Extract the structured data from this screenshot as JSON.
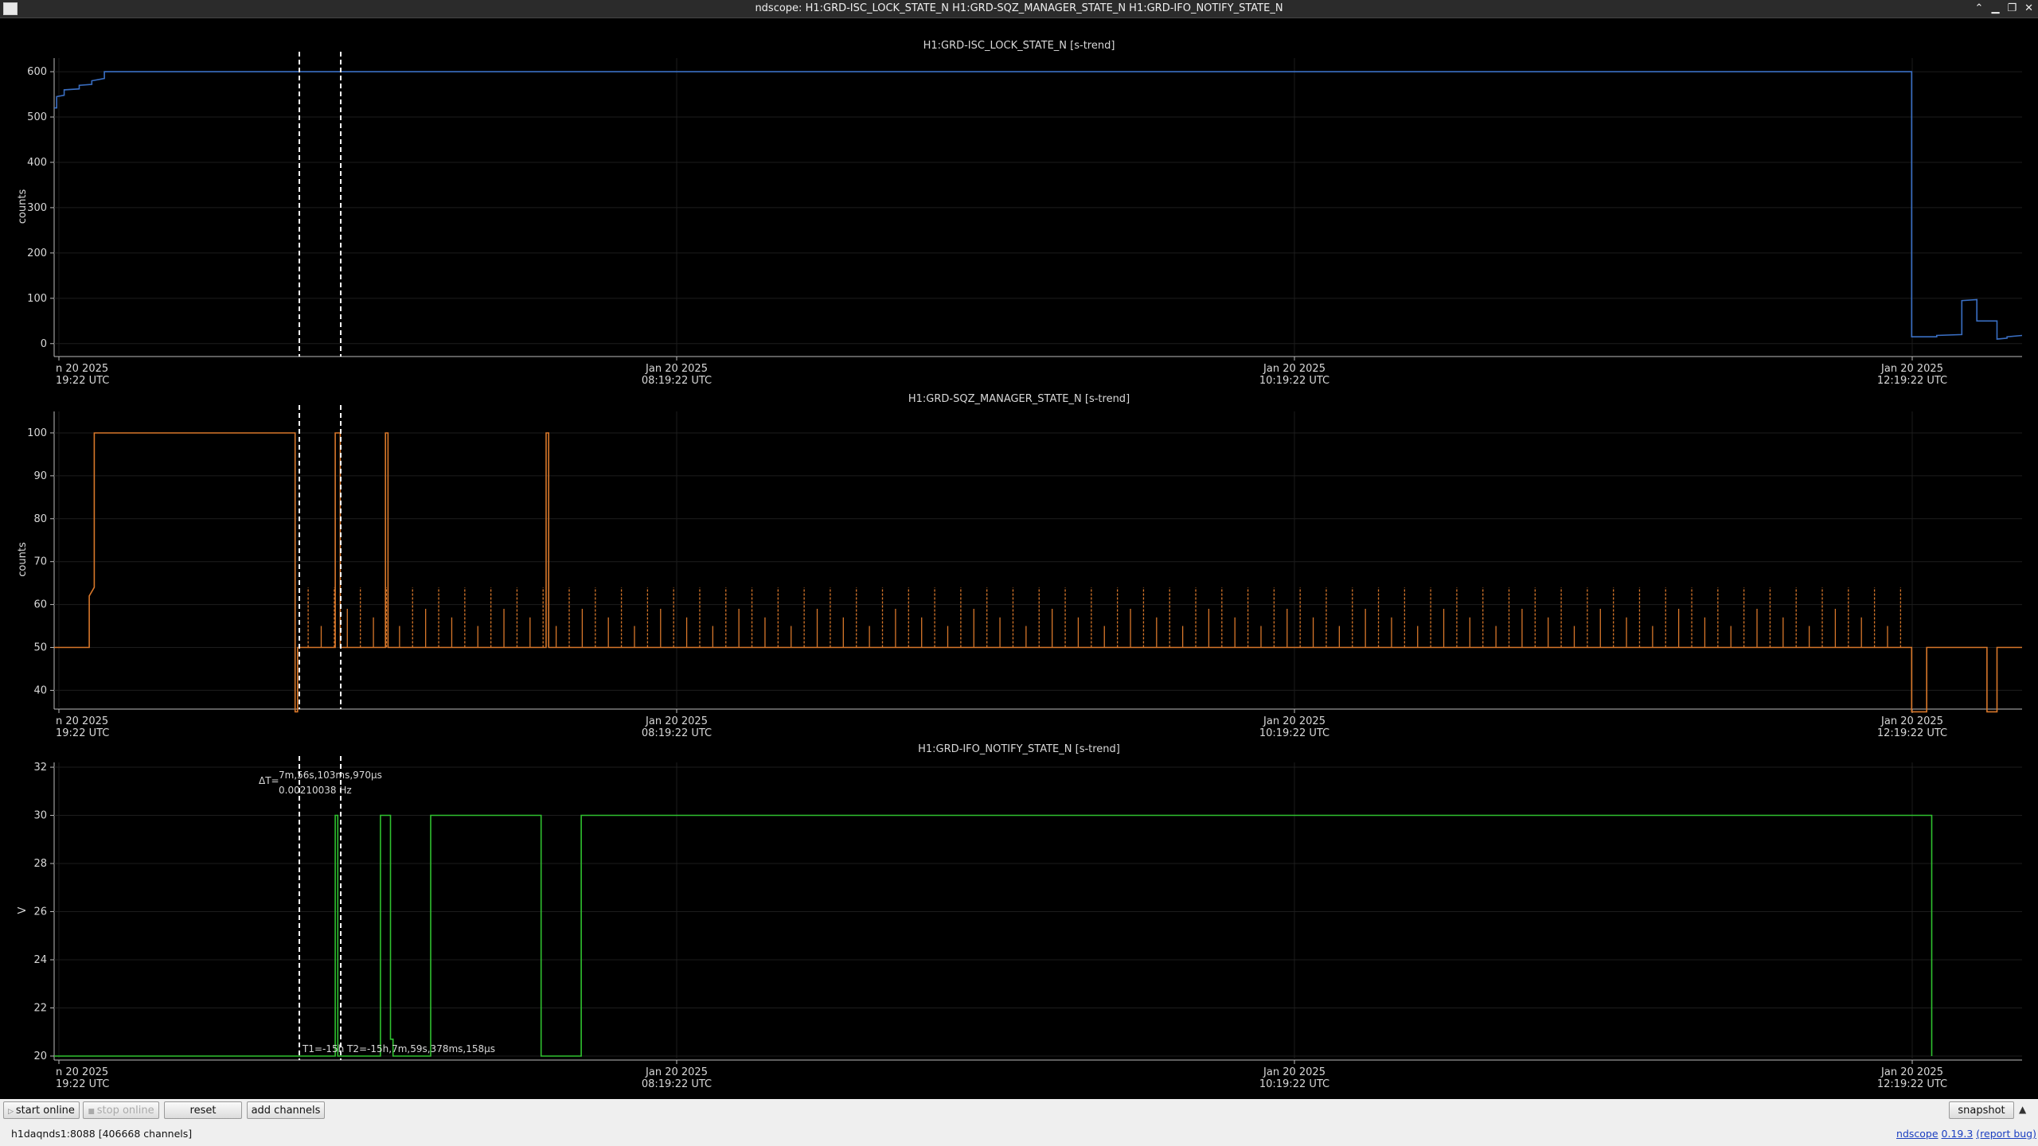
{
  "window": {
    "title": "ndscope: H1:GRD-ISC_LOCK_STATE_N H1:GRD-SQZ_MANAGER_STATE_N H1:GRD-IFO_NOTIFY_STATE_N",
    "buttons": {
      "minimize": "▁",
      "maximize": "❐",
      "close": "✕",
      "shade": "⌃"
    }
  },
  "time_ticks": [
    {
      "label1": "n 20 2025",
      "label2": "19:22 UTC"
    },
    {
      "label1": "Jan 20 2025",
      "label2": "08:19:22 UTC"
    },
    {
      "label1": "Jan 20 2025",
      "label2": "10:19:22 UTC"
    },
    {
      "label1": "Jan 20 2025",
      "label2": "12:19:22 UTC"
    }
  ],
  "cursors": {
    "delta_label": "ΔT=",
    "delta_time": "7m,56s,103ms,970µs",
    "delta_freq": "0.00210038 Hz",
    "t_labels": "T1=-15h T2=-15h,7m,59s,378ms,158µs"
  },
  "chart_data": [
    {
      "type": "line",
      "title": "H1:GRD-ISC_LOCK_STATE_N [s-trend]",
      "ylabel": "counts",
      "ylim": [
        -25,
        630
      ],
      "yticks": [
        "0",
        "100",
        "200",
        "300",
        "400",
        "500",
        "600"
      ],
      "color": "#3a6fc4",
      "series": [
        {
          "values": [
            [
              0,
              520
            ],
            [
              0.5,
              520
            ],
            [
              0.5,
              545
            ],
            [
              2,
              548
            ],
            [
              2,
              560
            ],
            [
              5,
              562
            ],
            [
              5,
              570
            ],
            [
              7.5,
              572
            ],
            [
              7.5,
              580
            ],
            [
              10,
              585
            ],
            [
              10,
              600
            ],
            [
              370,
              600
            ],
            [
              370,
              15
            ],
            [
              375,
              15
            ],
            [
              375,
              18
            ],
            [
              380,
              20
            ],
            [
              380,
              95
            ],
            [
              383,
              97
            ],
            [
              383,
              50
            ],
            [
              387,
              50
            ],
            [
              387,
              10
            ],
            [
              389,
              12
            ],
            [
              389,
              15
            ],
            [
              392,
              18
            ]
          ]
        }
      ]
    },
    {
      "type": "line",
      "title": "H1:GRD-SQZ_MANAGER_STATE_N [s-trend]",
      "ylabel": "counts",
      "ylim": [
        36,
        105
      ],
      "yticks": [
        "40",
        "50",
        "60",
        "70",
        "80",
        "90",
        "100"
      ],
      "color": "#d8772a",
      "series": [
        {
          "values": [
            [
              0,
              50
            ],
            [
              7,
              50
            ],
            [
              7,
              62
            ],
            [
              8,
              64
            ],
            [
              8,
              100
            ],
            [
              48,
              100
            ],
            [
              48,
              35
            ],
            [
              48.5,
              35
            ],
            [
              48.5,
              50
            ],
            [
              56,
              50
            ],
            [
              56,
              100
            ],
            [
              57,
              100
            ],
            [
              57,
              50
            ],
            [
              66,
              50
            ],
            [
              66,
              100
            ],
            [
              66.5,
              100
            ],
            [
              66.5,
              50
            ],
            [
              98,
              50
            ],
            [
              98,
              100
            ],
            [
              98.5,
              100
            ],
            [
              98.5,
              50
            ],
            [
              370,
              50
            ],
            [
              370,
              35
            ],
            [
              373,
              35
            ],
            [
              373,
              50
            ],
            [
              385,
              50
            ],
            [
              385,
              35
            ],
            [
              387,
              35
            ],
            [
              387,
              50
            ],
            [
              392,
              50
            ]
          ]
        }
      ],
      "spikes": {
        "from": 48,
        "to": 370,
        "step": 2.6,
        "heights": [
          57,
          64,
          55,
          64,
          59,
          64
        ]
      }
    },
    {
      "type": "line",
      "title": "H1:GRD-IFO_NOTIFY_STATE_N [s-trend]",
      "ylabel": "V",
      "ylim": [
        19.9,
        32.2
      ],
      "yticks": [
        "20",
        "22",
        "24",
        "26",
        "28",
        "30",
        "32"
      ],
      "color": "#2fc12f",
      "series": [
        {
          "values": [
            [
              0,
              20
            ],
            [
              48,
              20
            ],
            [
              56,
              20
            ],
            [
              56,
              30
            ],
            [
              56.5,
              30
            ],
            [
              56.5,
              20
            ],
            [
              65,
              20
            ],
            [
              65,
              30
            ],
            [
              67,
              30
            ],
            [
              67,
              20.7
            ],
            [
              67.5,
              20.7
            ],
            [
              67.5,
              20
            ],
            [
              75,
              20
            ],
            [
              75,
              30
            ],
            [
              97,
              30
            ],
            [
              97,
              20
            ],
            [
              105,
              20
            ],
            [
              105,
              30
            ],
            [
              374,
              30
            ],
            [
              374,
              20
            ]
          ]
        }
      ]
    }
  ],
  "toolbar": {
    "start_online": "start online",
    "stop_online": "stop online",
    "reset": "reset",
    "add_channels": "add channels",
    "snapshot": "snapshot",
    "expand": "▲"
  },
  "status": {
    "server": "h1daqnds1:8088 [406668 channels]",
    "app": "ndscope",
    "version": "0.19.3",
    "report": "(report bug)"
  }
}
